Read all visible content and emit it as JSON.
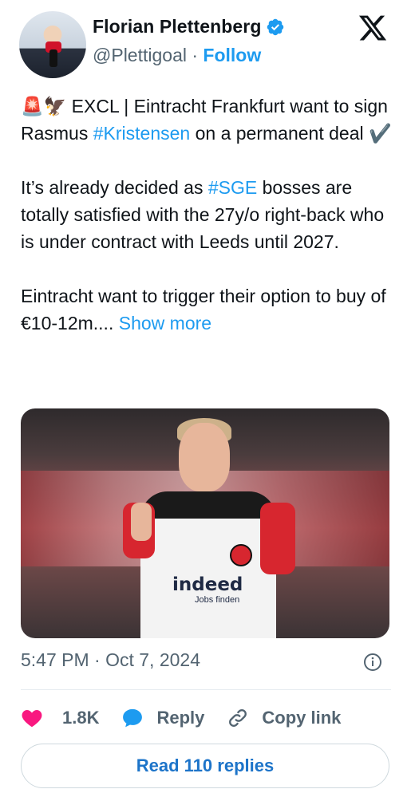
{
  "author": {
    "display_name": "Florian Plettenberg",
    "handle": "@Plettigoal",
    "separator": "·",
    "follow_label": "Follow"
  },
  "tweet": {
    "line1": "🚨🦅 EXCL | Eintracht Frankfurt want to sign Rasmus ",
    "hashtag1": "#Kristensen",
    "line1_end": " on a permanent deal ✔️",
    "para2_start": "It’s already decided as ",
    "hashtag2": "#SGE",
    "para2_end": " bosses are totally satisfied with the 27y/o right-back who is under contract with Leeds until 2027.",
    "para3": "Eintracht want to trigger their option to buy of €10-12m.... ",
    "show_more": "Show more"
  },
  "media": {
    "sponsor": "indeed",
    "sponsor_sub": "Jobs finden"
  },
  "meta": {
    "timestamp": "5:47 PM · Oct 7, 2024"
  },
  "actions": {
    "likes": "1.8K",
    "reply_label": "Reply",
    "copy_label": "Copy link"
  },
  "read_replies_label": "Read 110 replies",
  "colors": {
    "accent": "#1d9bf0",
    "like": "#f91880",
    "reply_icon": "#1d9bf0",
    "text_secondary": "#536471"
  }
}
